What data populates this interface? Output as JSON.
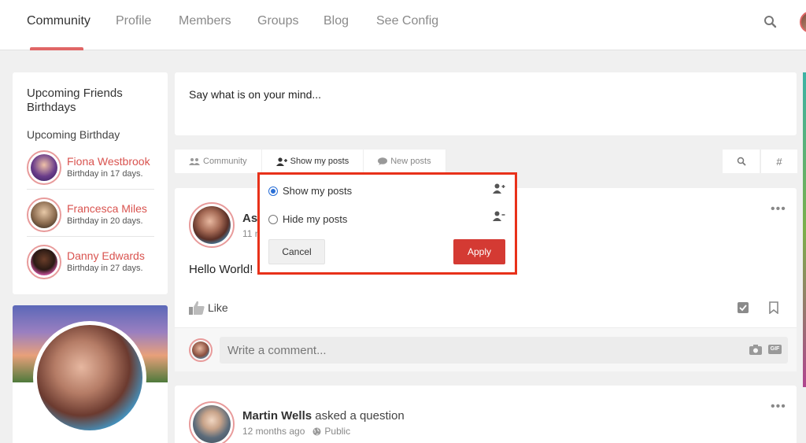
{
  "nav": {
    "items": [
      "Community",
      "Profile",
      "Members",
      "Groups",
      "Blog",
      "See Config"
    ],
    "active": "Community"
  },
  "birthdays": {
    "title": "Upcoming Friends Birthdays",
    "subtitle": "Upcoming Birthday",
    "people": [
      {
        "name": "Fiona Westbrook",
        "days": "Birthday in 17 days."
      },
      {
        "name": "Francesca Miles",
        "days": "Birthday in 20 days."
      },
      {
        "name": "Danny Edwards",
        "days": "Birthday in 27 days."
      }
    ]
  },
  "composer": {
    "placeholder": "Say what is on your mind..."
  },
  "tabs": [
    {
      "label": "Community",
      "icon": "users-icon"
    },
    {
      "label": "Show my posts",
      "icon": "user-plus-icon"
    },
    {
      "label": "New posts",
      "icon": "comment-icon"
    }
  ],
  "tools": {
    "search": "search-icon",
    "hashtag": "#"
  },
  "popover": {
    "options": [
      {
        "label": "Show my posts",
        "checked": true,
        "icon": "user-plus-icon"
      },
      {
        "label": "Hide my posts",
        "checked": false,
        "icon": "user-minus-icon"
      }
    ],
    "cancel": "Cancel",
    "apply": "Apply"
  },
  "post1": {
    "author_partial": "Ash",
    "time_partial": "11 n",
    "body": "Hello World!",
    "like": "Like",
    "comment_placeholder": "Write a comment...",
    "gif": "GIF"
  },
  "post2": {
    "author": "Martin Wells",
    "action": " asked a question",
    "time": "12 months ago",
    "privacy": "Public"
  },
  "colors": {
    "accent": "#d9534f",
    "highlight_border": "#e8311a",
    "apply": "#d43a33"
  }
}
